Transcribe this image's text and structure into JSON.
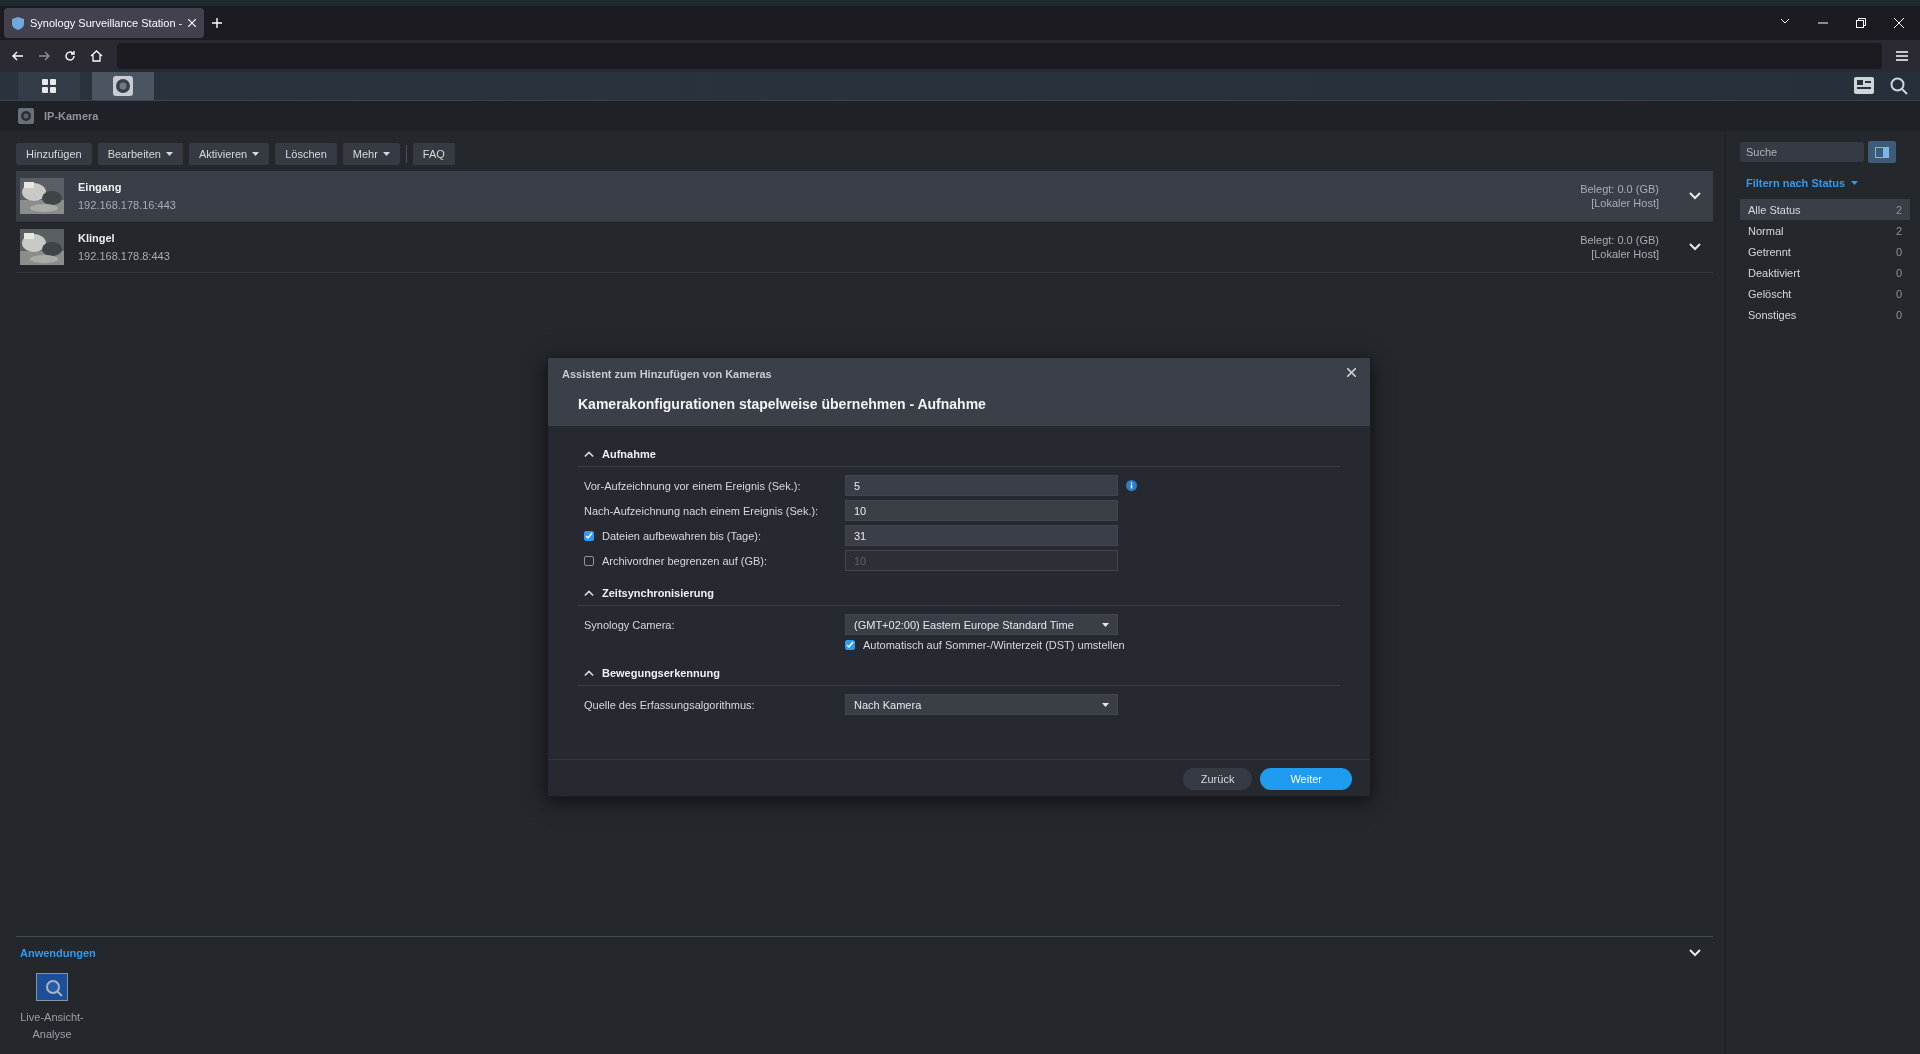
{
  "browser": {
    "tab_title": "Synology Surveillance Station -"
  },
  "app_window": {
    "title": "IP-Kamera"
  },
  "toolbar": {
    "buttons": [
      {
        "label": "Hinzufügen",
        "dropdown": false
      },
      {
        "label": "Bearbeiten",
        "dropdown": true
      },
      {
        "label": "Aktivieren",
        "dropdown": true
      },
      {
        "label": "Löschen",
        "dropdown": false
      },
      {
        "label": "Mehr",
        "dropdown": true
      },
      {
        "label": "FAQ",
        "dropdown": false
      }
    ],
    "search": {
      "placeholder": "Suche"
    }
  },
  "cameras": [
    {
      "name": "Eingang",
      "address": "192.168.178.16:443",
      "usage": "Belegt: 0.0 (GB)",
      "host": "[Lokaler Host]",
      "selected": true
    },
    {
      "name": "Klingel",
      "address": "192.168.178.8:443",
      "usage": "Belegt: 0.0 (GB)",
      "host": "[Lokaler Host]",
      "selected": false
    }
  ],
  "filter": {
    "title": "Filtern nach Status",
    "items": [
      {
        "label": "Alle Status",
        "count": "2",
        "selected": true
      },
      {
        "label": "Normal",
        "count": "2",
        "selected": false
      },
      {
        "label": "Getrennt",
        "count": "0",
        "selected": false
      },
      {
        "label": "Deaktiviert",
        "count": "0",
        "selected": false
      },
      {
        "label": "Gelöscht",
        "count": "0",
        "selected": false
      },
      {
        "label": "Sonstiges",
        "count": "0",
        "selected": false
      }
    ]
  },
  "dialog": {
    "caption": "Assistent zum Hinzufügen von Kameras",
    "title": "Kamerakonfigurationen stapelweise übernehmen - Aufnahme",
    "sections": [
      {
        "title": "Aufnahme",
        "expanded": true,
        "rows": [
          {
            "kind": "input",
            "label": "Vor-Aufzeichnung vor einem Ereignis (Sek.):",
            "value": "5",
            "info": true,
            "disabled": false
          },
          {
            "kind": "input",
            "label": "Nach-Aufzeichnung nach einem Ereignis (Sek.):",
            "value": "10",
            "info": false,
            "disabled": false
          },
          {
            "kind": "check-input",
            "label": "Dateien aufbewahren bis (Tage):",
            "checked": true,
            "value": "31",
            "info": false,
            "disabled": false
          },
          {
            "kind": "check-input",
            "label": "Archivordner begrenzen auf (GB):",
            "checked": false,
            "value": "10",
            "info": false,
            "disabled": true
          }
        ]
      },
      {
        "title": "Zeitsynchronisierung",
        "expanded": true,
        "rows": [
          {
            "kind": "select",
            "label": "Synology Camera:",
            "value": "(GMT+02:00) Eastern Europe Standard Time"
          },
          {
            "kind": "check",
            "label": "Automatisch auf Sommer-/Winterzeit (DST) umstellen",
            "checked": true
          }
        ]
      },
      {
        "title": "Bewegungserkennung",
        "expanded": true,
        "rows": [
          {
            "kind": "select",
            "label": "Quelle des Erfassungsalgorithmus:",
            "value": "Nach Kamera"
          }
        ]
      }
    ],
    "buttons": [
      {
        "label": "Zurück",
        "primary": false
      },
      {
        "label": "Weiter",
        "primary": true
      }
    ]
  },
  "applications": {
    "title": "Anwendungen",
    "items": [
      {
        "label": "Live-Ansicht-Analyse"
      }
    ]
  }
}
